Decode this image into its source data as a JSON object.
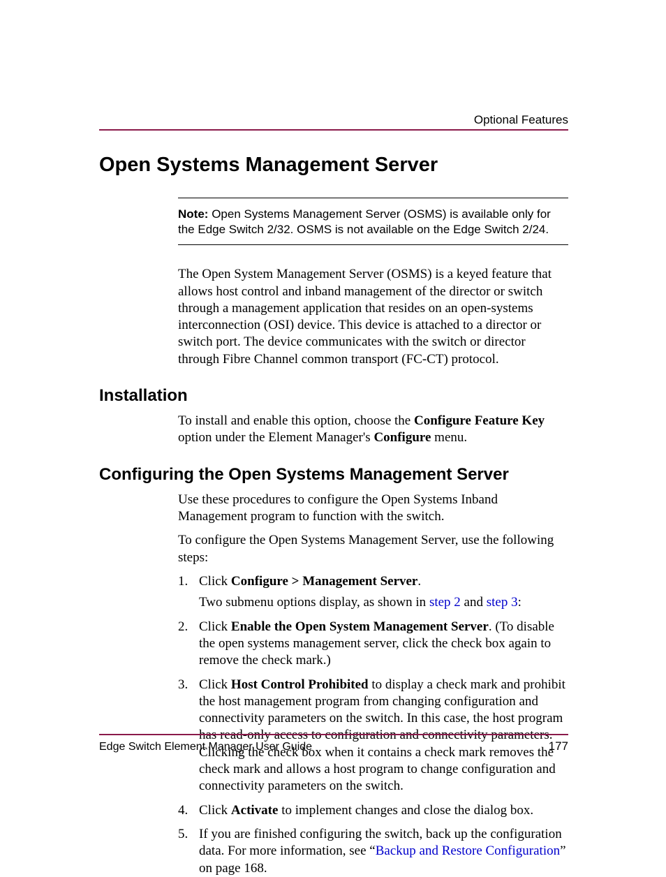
{
  "header": {
    "running_head": "Optional Features"
  },
  "title": "Open Systems Management Server",
  "note": {
    "label": "Note:",
    "text": "Open Systems Management Server (OSMS) is available only for the Edge Switch 2/32. OSMS is not available on the Edge Switch 2/24."
  },
  "intro": "The Open System Management Server (OSMS) is a keyed feature that allows host control and inband management of the director or switch through a management application that resides on an open-systems interconnection (OSI) device. This device is attached to a director or switch port. The device communicates with the switch or director through Fibre Channel common transport (FC-CT) protocol.",
  "installation": {
    "heading": "Installation",
    "p_before": "To install and enable this option, choose the ",
    "bold1": "Configure Feature Key",
    "p_mid": " option under the Element Manager's ",
    "bold2": "Configure",
    "p_after": " menu."
  },
  "config": {
    "heading": "Configuring the Open Systems Management Server",
    "p1": "Use these procedures to configure the Open Systems Inband Management program to function with the switch.",
    "p2": "To configure the Open Systems Management Server, use the following steps:",
    "steps": {
      "s1": {
        "pre": "Click ",
        "bold": "Configure > Management Server",
        "post": ".",
        "sub_pre": "Two submenu options display, as shown in ",
        "link1": "step 2",
        "sub_mid": " and ",
        "link2": "step 3",
        "sub_post": ":"
      },
      "s2": {
        "pre": "Click ",
        "bold": "Enable the Open System Management Server",
        "post": ". (To disable the open systems management server, click the check box again to remove the check mark.)"
      },
      "s3": {
        "pre": "Click ",
        "bold": "Host Control Prohibited",
        "post": " to display a check mark and prohibit the host management program from changing configuration and connectivity parameters on the switch. In this case, the host program has read-only access to configuration and connectivity parameters. Clicking the check box when it contains a check mark removes the check mark and allows a host program to change configuration and connectivity parameters on the switch."
      },
      "s4": {
        "pre": "Click ",
        "bold": "Activate",
        "post": " to implement changes and close the dialog box."
      },
      "s5": {
        "pre": "If you are finished configuring the switch, back up the configuration data. For more information, see “",
        "link": "Backup and Restore Configuration",
        "post": "” on page 168."
      }
    }
  },
  "footer": {
    "left": "Edge Switch Element Manager User Guide",
    "page": "177"
  }
}
